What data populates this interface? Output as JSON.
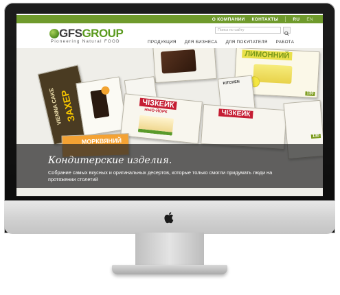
{
  "topnav": {
    "about": "О КОМПАНИИ",
    "contacts": "КОНТАКТЫ",
    "lang_ru": "RU",
    "lang_en": "EN"
  },
  "logo": {
    "text_part1": "GFS",
    "text_part2": "GROUP",
    "tagline": "Pioneering Natural FOOD"
  },
  "search": {
    "placeholder": "Поиск по сайту"
  },
  "mainnav": {
    "items": [
      "ПРОДУКЦИЯ",
      "ДЛЯ БИЗНЕСА",
      "ДЛЯ ПОКУПАТЕЛЯ",
      "РАБОТА"
    ]
  },
  "hero": {
    "packages": {
      "lemon": "ЛИМОННИЙ",
      "cheesecake": "ЧІЗКЕЙК",
      "cheesecake_sub": "НЬЮ-ЙОРК",
      "vienna": "VIENNA CAKE",
      "zaher": "ЗАХЕР",
      "carrot": "МОРКВЯНИЙ",
      "carrot_cake": "ЧІЗКЕЙК",
      "price_1": "130",
      "price_2": "130",
      "kitchen": "KITCHEN"
    },
    "title": "Кондитерские изделия.",
    "description": "Собрание самых вкусных и оригинальных десертов, которые только смогли придумать люди на протяжении столетий"
  },
  "colors": {
    "accent_green": "#6f9a2c",
    "logo_green": "#5a9a1e",
    "caption_bg": "#282828"
  }
}
